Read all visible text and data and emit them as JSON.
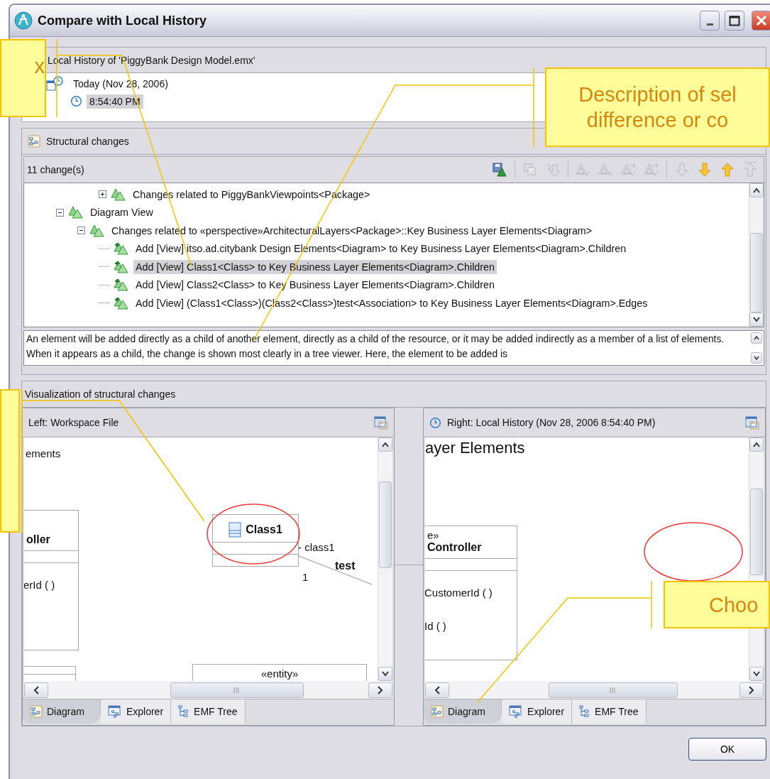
{
  "window": {
    "title": "Compare with Local History"
  },
  "history": {
    "title": "Local History of 'PiggyBank Design Model.emx'",
    "items": [
      {
        "label": "Today (Nov 28, 2006)",
        "selected": false,
        "children": [
          {
            "label": "8:54:40 PM",
            "selected": true
          }
        ]
      }
    ]
  },
  "structural_changes": {
    "title": "Structural changes",
    "count": "11 change(s)",
    "toolbar": [
      [
        {
          "kind": "save",
          "disabled": false
        }
      ],
      [
        {
          "kind": "copy",
          "disabled": true
        },
        {
          "kind": "star-arrow",
          "disabled": true
        }
      ],
      [
        {
          "kind": "accept",
          "disabled": true
        },
        {
          "kind": "reject",
          "disabled": true
        },
        {
          "kind": "accept-right",
          "disabled": true
        },
        {
          "kind": "accept-left",
          "disabled": true
        }
      ],
      [
        {
          "kind": "down-outline",
          "disabled": true
        },
        {
          "kind": "down",
          "disabled": false
        },
        {
          "kind": "up",
          "disabled": false
        },
        {
          "kind": "top",
          "disabled": true
        }
      ]
    ],
    "tree": [
      {
        "children": [
          {
            "children": [
              {
                "label": "Changes related to PiggyBankViewpoints<Package>",
                "kind": "group",
                "expanded": false,
                "selected": false
              }
            ]
          }
        ]
      },
      {
        "label": "Diagram View",
        "kind": "group",
        "expanded": true,
        "selected": false,
        "children": [
          {
            "label": "Changes related to «perspective»ArchitecturalLayers<Package>::Key Business Layer Elements<Diagram>",
            "kind": "group",
            "expanded": true,
            "selected": false,
            "children": [
              {
                "label": "Add [View] itso.ad.citybank Design Elements<Diagram> to Key Business Layer Elements<Diagram>.Children",
                "kind": "add",
                "selected": false
              },
              {
                "label": "Add [View] Class1<Class> to Key Business Layer Elements<Diagram>.Children",
                "kind": "add",
                "selected": true
              },
              {
                "label": "Add [View] Class2<Class> to Key Business Layer Elements<Diagram>.Children",
                "kind": "add",
                "selected": false
              },
              {
                "label": "Add [View] (Class1<Class>)(Class2<Class>)test<Association> to Key Business Layer Elements<Diagram>.Edges",
                "kind": "add",
                "selected": false
              }
            ]
          }
        ]
      }
    ],
    "description": "An element will be added directly as a child of another element, directly as a child of the resource, or it may be added indirectly as a member of a list of elements. When it appears as a child, the change is shown most clearly in a tree viewer. Here, the element to be added is"
  },
  "visualization": {
    "title": "Visualization of structural changes",
    "panes": [
      {
        "title": "Left: Workspace File",
        "kind": "workspace",
        "tabs": [
          {
            "label": "Diagram",
            "selected": true
          },
          {
            "label": "Explorer",
            "selected": false
          },
          {
            "label": "EMF Tree",
            "selected": false
          }
        ],
        "diagram": [
          {
            "kind": "heading",
            "text": "ements"
          },
          {
            "kind": "class",
            "name": "oller",
            "operations": [
              "erId ( )"
            ]
          },
          {
            "kind": "class",
            "name": "Class1",
            "show_icon": true
          },
          {
            "kind": "label",
            "text": "- class1"
          },
          {
            "kind": "bold-label",
            "text": "test"
          },
          {
            "kind": "label",
            "text": "1"
          },
          {
            "kind": "class",
            "stereotype": "«entity»"
          },
          {
            "kind": "class"
          }
        ]
      },
      {
        "title": "Right: Local History (Nov 28, 2006 8:54:40 PM)",
        "kind": "history",
        "tabs": [
          {
            "label": "Diagram",
            "selected": true
          },
          {
            "label": "Explorer",
            "selected": false
          },
          {
            "label": "EMF Tree",
            "selected": false
          }
        ],
        "diagram": [
          {
            "kind": "heading",
            "text": "ayer Elements"
          },
          {
            "kind": "class",
            "stereotype": "e»",
            "name": "Controller",
            "operations": [
              "CustomerId ( )",
              "Id ( )"
            ]
          }
        ]
      }
    ]
  },
  "buttons": [
    "OK"
  ],
  "callouts": [
    {
      "kind": "callout",
      "text": "x"
    },
    {
      "kind": "callout",
      "text": "Description of sel\ndifference or co"
    },
    {
      "kind": "callout"
    },
    {
      "kind": "callout",
      "text": "Choo"
    }
  ]
}
